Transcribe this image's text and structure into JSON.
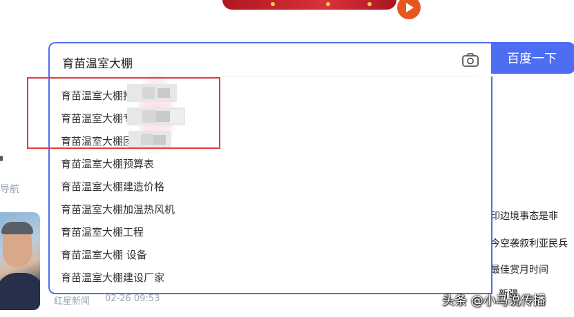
{
  "search": {
    "query": "育苗温室大棚",
    "button_label": "百度一下"
  },
  "suggestions": [
    "育苗温室大棚推荐",
    "育苗温室大棚专业",
    "育苗温室大棚团",
    "育苗温室大棚预算表",
    "育苗温室大棚建造价格",
    "育苗温室大棚加温热风机",
    "育苗温室大棚工程",
    "育苗温室大棚 设备",
    "育苗温室大棚建设厂家"
  ],
  "sidebar": {
    "nav_text": "导航"
  },
  "news_card": {
    "source": "红星新闻",
    "time": "02-26 09:53"
  },
  "hot_news": [
    "印边境事态是非",
    "今空袭叙利亚民兵",
    "最佳赏月时间",
    "新疆"
  ],
  "watermark": "头条 @小马说传播",
  "colors": {
    "accent": "#4e6ef2",
    "highlight_box": "#e8373a"
  }
}
